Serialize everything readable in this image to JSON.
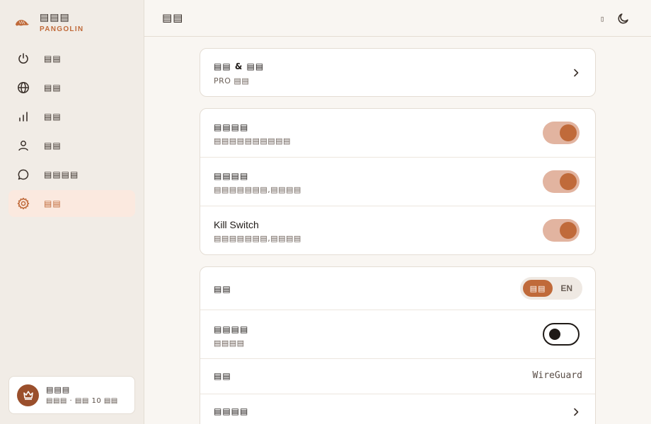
{
  "brand": {
    "name": "▤▤▤",
    "subtitle": "PANGOLIN"
  },
  "nav": {
    "items": [
      {
        "label": "▤▤",
        "icon": "power-icon"
      },
      {
        "label": "▤▤",
        "icon": "globe-icon"
      },
      {
        "label": "▤▤",
        "icon": "bar-chart-icon"
      },
      {
        "label": "▤▤",
        "icon": "user-icon"
      },
      {
        "label": "▤▤▤▤",
        "icon": "chat-icon"
      },
      {
        "label": "▤▤",
        "icon": "gear-icon",
        "active": true
      }
    ]
  },
  "user": {
    "name": "▤▤▤",
    "plan": "▤▤▤ · ▤▤ 10 ▤▤",
    "icon": "crown-icon"
  },
  "header": {
    "title": "▤▤",
    "glyph": "▯",
    "theme_icon": "moon-icon"
  },
  "cards": {
    "account": {
      "title": "▤▤ & ▤▤",
      "subtitle": "PRO ▤▤"
    },
    "connection": {
      "rows": [
        {
          "title": "▤▤▤▤",
          "subtitle": "▤▤▤▤▤▤▤▤▤▤",
          "toggle": true
        },
        {
          "title": "▤▤▤▤",
          "subtitle": "▤▤▤▤▤▤▤,▤▤▤▤",
          "toggle": true
        },
        {
          "title": "Kill Switch",
          "subtitle": "▤▤▤▤▤▤▤,▤▤▤▤",
          "toggle": true
        }
      ]
    },
    "general": {
      "language": {
        "title": "▤▤",
        "option_a": "▤▤",
        "option_b": "EN",
        "selected": "option_a"
      },
      "dark_mode": {
        "title": "▤▤▤▤",
        "subtitle": "▤▤▤▤",
        "toggle": false
      },
      "protocol": {
        "title": "▤▤",
        "value": "WireGuard"
      },
      "more": {
        "title": "▤▤▤▤"
      }
    }
  },
  "colors": {
    "accent": "#c06a3a",
    "accent_soft": "#e2b4a0",
    "active_bg": "#fbe9df"
  }
}
